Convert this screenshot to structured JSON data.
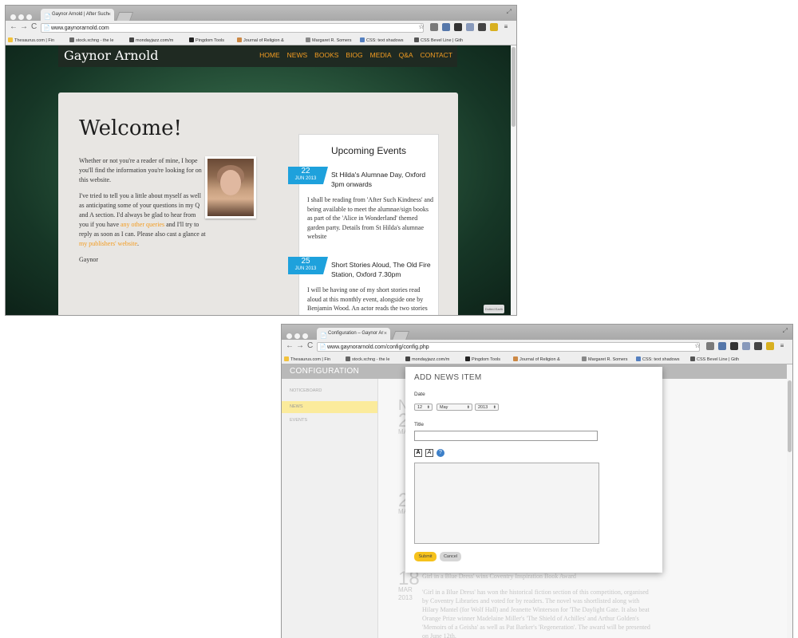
{
  "browser": {
    "tab_close_glyph": "×",
    "nav_back": "←",
    "nav_forward": "→",
    "nav_reload": "C",
    "url_icon_glyph": "📄",
    "star_glyph": "☆",
    "menu_glyph": "≡",
    "resize_glyph": "⤢",
    "bookmarks": [
      "Thesaurus.com | Fin",
      "stock.xchng - the le",
      "mondayjazz.com/m",
      "Pingdom Tools",
      "Journal of Religion &",
      "Margaret R. Somers",
      "CSS: text shadows",
      "CSS Bevel Line | Gith"
    ],
    "bookmarks2": [
      "Thesaurus.com | Fin",
      "stock.xchng - the le",
      "mondayjazz.com/m",
      "Pingdom Tools",
      "Journal of Religion &",
      "Margaret R. Somers",
      "CSS: text shadows",
      "CSS Bevel Line | Gith"
    ]
  },
  "window1": {
    "tab_title": "Gaynor Arnold | After Such",
    "url": "www.gaynorarnold.com",
    "site_name": "Gaynor Arnold",
    "nav": [
      "HOME",
      "NEWS",
      "BOOKS",
      "BIOG",
      "MEDIA",
      "Q&A",
      "CONTACT"
    ],
    "heading": "Welcome!",
    "intro_p1": "Whether or not you're a reader of mine, I hope you'll find the information you're looking for on this website.",
    "intro_p2a": "I've tried to tell you a little about myself as well as anticipating some of your questions in my Q and A section. I'd always be glad to hear from you if you have ",
    "intro_link1": "any other queries",
    "intro_p2b": " and I'll try to reply as soon as I can. Please also cast a glance at ",
    "intro_link2": "my publishers' website",
    "intro_p2c": ".",
    "signature": "Gaynor",
    "events_title": "Upcoming Events",
    "events": [
      {
        "day": "22",
        "month": "JUN 2013",
        "title": "St Hilda's Alumnae Day, Oxford 3pm onwards",
        "body": "I shall be reading from 'After Such Kindness' and being available to meet the alumnae/sign books as part of the 'Alice in Wonderland' themed garden party. Details from St Hilda's alumnae website"
      },
      {
        "day": "25",
        "month": "JUN 2013",
        "title": "Short Stories Aloud, The Old Fire Station, Oxford 7.30pm",
        "body": "I will be having one of my short stories read aloud at this monthly event, alongside one by Benjamin Wood. An actor reads the two stories and the writers answer"
      }
    ],
    "corner_badge": "Dotted Earth"
  },
  "window2": {
    "tab_title": "Configuration – Gaynor Ar",
    "url": "www.gaynorarnold.com/config/config.php",
    "header": "CONFIGURATION",
    "sidebar": [
      "NOTICEBOARD",
      "NEWS",
      "EVENTS"
    ],
    "bg_letter": "N",
    "bg_items": [
      {
        "day": "2",
        "month": "MAR"
      },
      {
        "day": "2",
        "month": "MAR"
      },
      {
        "day": "18",
        "month": "MAR",
        "year": "2013",
        "heading": "Girl in a Blue Dress' wins Coventry Inspiration Book Award",
        "text": "'Girl in a Blue Dress' has won the  historical fiction section of this competition, organised by Coventry Libraries and voted for by readers. The novel was shortlisted along with Hilary Mantel (for Wolf Hall) and Jeanette Winterson for 'The Daylight Gate. It also beat Orange Prize winner Madelaine Miller's 'The Shield of Achilles' and Arthur Golden's 'Memoirs of a Geisha' as well as Pat Barker's 'Regeneration'. The award will be presented on June 12th."
      }
    ],
    "modal": {
      "title": "ADD NEWS ITEM",
      "date_label": "Date",
      "day": "12",
      "month": "May",
      "year": "2013",
      "title_label": "Title",
      "bold_btn": "A",
      "italic_btn": "A",
      "help_btn": "?",
      "submit": "Submit",
      "cancel": "Cancel"
    }
  }
}
